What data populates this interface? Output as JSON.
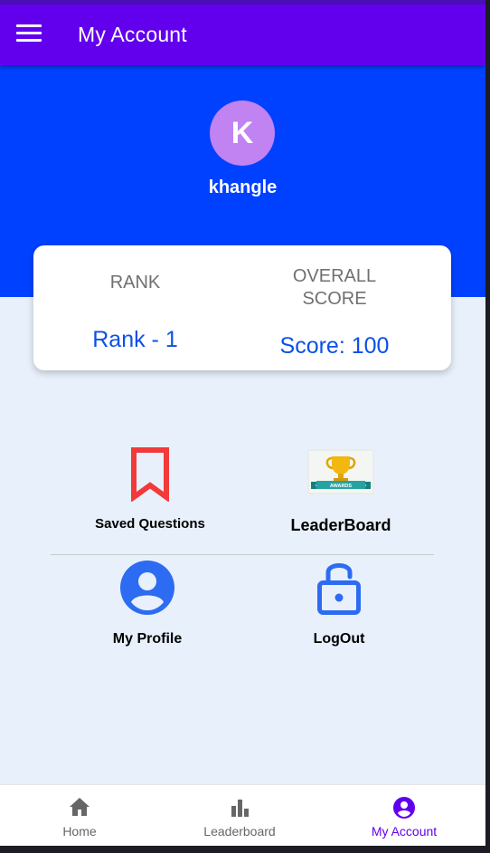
{
  "appbar": {
    "title": "My Account",
    "menu_icon": "hamburger-menu-icon"
  },
  "profile": {
    "avatar_initial": "K",
    "username": "khangle"
  },
  "stats": {
    "rank_label": "RANK",
    "rank_value": "Rank - 1",
    "score_label_line1": "OVERALL",
    "score_label_line2": "SCORE",
    "score_value": "Score: 100"
  },
  "tiles": {
    "saved": {
      "label": "Saved Questions",
      "icon": "bookmark-icon"
    },
    "leaderboard": {
      "label": "LeaderBoard",
      "icon": "trophy-awards-icon",
      "badge_text": "AWARDS"
    },
    "profile": {
      "label": "My Profile",
      "icon": "account-circle-icon"
    },
    "logout": {
      "label": "LogOut",
      "icon": "unlock-icon"
    }
  },
  "bottom_nav": {
    "home": "Home",
    "leaderboard": "Leaderboard",
    "account": "My Account",
    "active": "My Account"
  },
  "colors": {
    "appbar": "#6200ee",
    "header": "#0041ff",
    "avatar": "#c182f2",
    "accent_blue": "#0b50e8",
    "bookmark_red": "#f23a3a",
    "icon_blue": "#2d6cf2"
  }
}
